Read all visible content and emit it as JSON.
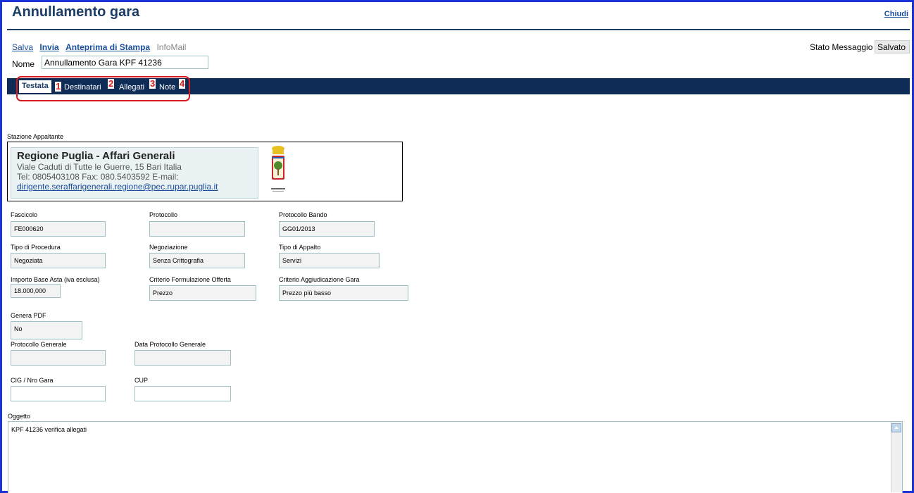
{
  "window": {
    "title": "Annullamento gara",
    "close_label": "Chiudi"
  },
  "toolbar": {
    "save_label": "Salva",
    "send_label": "Invia",
    "print_preview_label": "Anteprima di Stampa",
    "infomail_label": "InfoMail"
  },
  "nome": {
    "label": "Nome",
    "value": "Annullamento Gara KPF 41236"
  },
  "stato": {
    "label": "Stato Messaggio",
    "value": "Salvato"
  },
  "tabs": [
    {
      "label": "Testata",
      "number": "1"
    },
    {
      "label": "Destinatari",
      "number": "2"
    },
    {
      "label": "Allegati",
      "number": "3"
    },
    {
      "label": "Note",
      "number": "4"
    }
  ],
  "stazione": {
    "section_label": "Stazione Appaltante",
    "name": "Regione Puglia - Affari Generali",
    "address": "Viale Caduti di Tutte le Guerre, 15 Bari Italia",
    "contacts": "Tel: 0805403108 Fax: 080.5403592 E-mail:",
    "email": "dirigente.seraffarigenerali.regione@pec.rupar.puglia.it",
    "logo_caption": "Regione Puglia"
  },
  "fields": {
    "fascicolo": {
      "label": "Fascicolo",
      "value": "FE000620"
    },
    "protocollo": {
      "label": "Protocollo",
      "value": ""
    },
    "protocollo_bando": {
      "label": "Protocollo Bando",
      "value": "GG01/2013"
    },
    "tipo_procedura": {
      "label": "Tipo di Procedura",
      "value": "Negoziata"
    },
    "negoziazione": {
      "label": "Negoziazione",
      "value": "Senza Crittografia"
    },
    "tipo_appalto": {
      "label": "Tipo di Appalto",
      "value": "Servizi"
    },
    "importo_base": {
      "label": "Importo Base Asta (iva esclusa)",
      "value": "18.000,000"
    },
    "criterio_formulazione": {
      "label": "Criterio Formulazione Offerta",
      "value": "Prezzo"
    },
    "criterio_aggiudicazione": {
      "label": "Criterio Aggiudicazione Gara",
      "value": "Prezzo più basso"
    },
    "genera_pdf": {
      "label": "Genera PDF",
      "value": "No"
    },
    "protocollo_generale": {
      "label": "Protocollo Generale",
      "value": ""
    },
    "data_protocollo_generale": {
      "label": "Data Protocollo Generale",
      "value": ""
    },
    "cig": {
      "label": "CIG / Nro Gara",
      "value": ""
    },
    "cup": {
      "label": "CUP",
      "value": ""
    },
    "oggetto": {
      "label": "Oggetto",
      "value": "KPF 41236 verifica allegati"
    }
  },
  "colors": {
    "frame_border": "#1a33d6",
    "title": "#1c3d66",
    "tab_bar": "#0f2c57",
    "link": "#1a4f9c",
    "annotation_red": "#d61c1c"
  }
}
